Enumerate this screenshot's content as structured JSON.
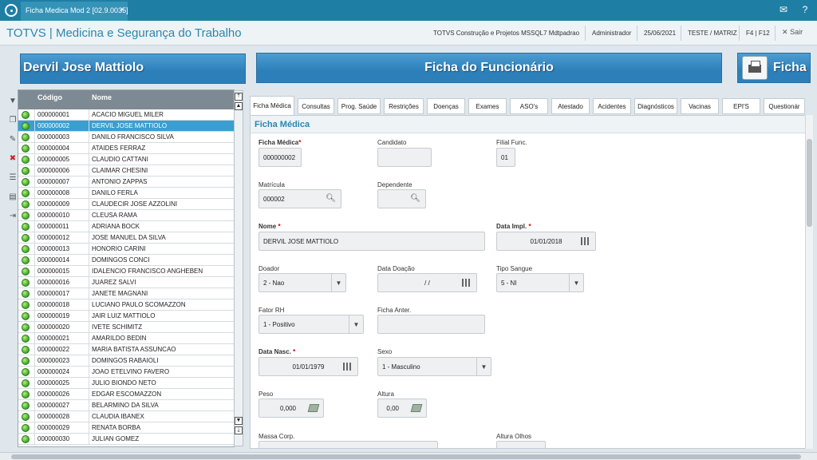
{
  "topbar": {
    "tab_title": "Ficha Medica Mod 2 [02.9.0035]",
    "tab_close": "×",
    "mail_icon": "mail-icon",
    "help_icon": "help-icon"
  },
  "header": {
    "app_title": "TOTVS | Medicina e Segurança do Trabalho",
    "company": "TOTVS Construção e Projetos MSSQL7 Mdtpadrao",
    "user": "Administrador",
    "date": "25/06/2021",
    "branch": "TESTE / MATRIZ",
    "keys": "F4 | F12",
    "exit_label": "Sair"
  },
  "left_banner": {
    "name": "Dervil Jose Mattiolo"
  },
  "main_banner": {
    "title": "Ficha do Funcionário"
  },
  "print_banner": {
    "label": "Ficha"
  },
  "list": {
    "columns": [
      "Código",
      "Nome"
    ],
    "selected_index": 1,
    "rows": [
      {
        "code": "000000001",
        "name": "ACACIO MIGUEL MILER"
      },
      {
        "code": "000000002",
        "name": "DERVIL JOSE MATTIOLO"
      },
      {
        "code": "000000003",
        "name": "DANILO FRANCISCO SILVA"
      },
      {
        "code": "000000004",
        "name": "ATAIDES FERRAZ"
      },
      {
        "code": "000000005",
        "name": "CLAUDIO CATTANI"
      },
      {
        "code": "000000006",
        "name": "CLAIMAR CHESINI"
      },
      {
        "code": "000000007",
        "name": "ANTONIO ZAPPAS"
      },
      {
        "code": "000000008",
        "name": "DANILO FERLA"
      },
      {
        "code": "000000009",
        "name": "CLAUDECIR JOSE AZZOLINI"
      },
      {
        "code": "000000010",
        "name": "CLEUSA RAMA"
      },
      {
        "code": "000000011",
        "name": "ADRIANA BOCK"
      },
      {
        "code": "000000012",
        "name": "JOSE MANUEL DA SILVA"
      },
      {
        "code": "000000013",
        "name": "HONORIO CARINI"
      },
      {
        "code": "000000014",
        "name": "DOMINGOS CONCI"
      },
      {
        "code": "000000015",
        "name": "IDALENCIO FRANCISCO ANGHEBEN"
      },
      {
        "code": "000000016",
        "name": "JUAREZ SALVI"
      },
      {
        "code": "000000017",
        "name": "JANETE MAGNANI"
      },
      {
        "code": "000000018",
        "name": "LUCIANO PAULO SCOMAZZON"
      },
      {
        "code": "000000019",
        "name": "JAIR LUIZ MATTIOLO"
      },
      {
        "code": "000000020",
        "name": "IVETE SCHIMITZ"
      },
      {
        "code": "000000021",
        "name": "AMARILDO BEDIN"
      },
      {
        "code": "000000022",
        "name": "MARIA BATISTA ASSUNCAO"
      },
      {
        "code": "000000023",
        "name": "DOMINGOS RABAIOLI"
      },
      {
        "code": "000000024",
        "name": "JOAO ETELVINO FAVERO"
      },
      {
        "code": "000000025",
        "name": "JULIO BIONDO NETO"
      },
      {
        "code": "000000026",
        "name": "EDGAR ESCOMAZZON"
      },
      {
        "code": "000000027",
        "name": "BELARMINO DA SILVA"
      },
      {
        "code": "000000028",
        "name": "CLAUDIA IBANEX"
      },
      {
        "code": "000000029",
        "name": "RENATA BORBA"
      },
      {
        "code": "000000030",
        "name": "JULIAN GOMEZ"
      }
    ]
  },
  "tabs": [
    "Ficha Médica",
    "Consultas",
    "Prog. Saúde",
    "Restrições",
    "Doenças",
    "Exames",
    "ASO's",
    "Atestado",
    "Acidentes",
    "Diagnósticos",
    "Vacinas",
    "EPI'S",
    "Questionár"
  ],
  "form": {
    "section_title": "Ficha Médica",
    "ficha_medica": {
      "label": "Ficha Médica",
      "required": "*",
      "value": "000000002"
    },
    "candidato": {
      "label": "Candidato",
      "value": ""
    },
    "filial_func": {
      "label": "Filial Func.",
      "value": "01"
    },
    "matricula": {
      "label": "Matrícula",
      "value": "000002"
    },
    "dependente": {
      "label": "Dependente",
      "value": ""
    },
    "nome": {
      "label": "Nome",
      "required": "*",
      "value": "DERVIL JOSE MATTIOLO"
    },
    "data_impl": {
      "label": "Data Impl.",
      "required": "*",
      "value": "01/01/2018"
    },
    "doador": {
      "label": "Doador",
      "value": "2 - Nao"
    },
    "data_doacao": {
      "label": "Data Doação",
      "value": "/ /"
    },
    "tipo_sangue": {
      "label": "Tipo Sangue",
      "value": "5 - NI"
    },
    "fator_rh": {
      "label": "Fator RH",
      "value": "1 - Positivo"
    },
    "ficha_anter": {
      "label": "Ficha Anter.",
      "value": ""
    },
    "data_nasc": {
      "label": "Data Nasc.",
      "required": "*",
      "value": "01/01/1979"
    },
    "sexo": {
      "label": "Sexo",
      "value": "1 - Masculino"
    },
    "peso": {
      "label": "Peso",
      "value": "0,000"
    },
    "altura": {
      "label": "Altura",
      "value": "0,00"
    },
    "massa_corp": {
      "label": "Massa Corp.",
      "value": ""
    },
    "altura_olhos": {
      "label": "Altura Olhos",
      "value": ""
    }
  }
}
